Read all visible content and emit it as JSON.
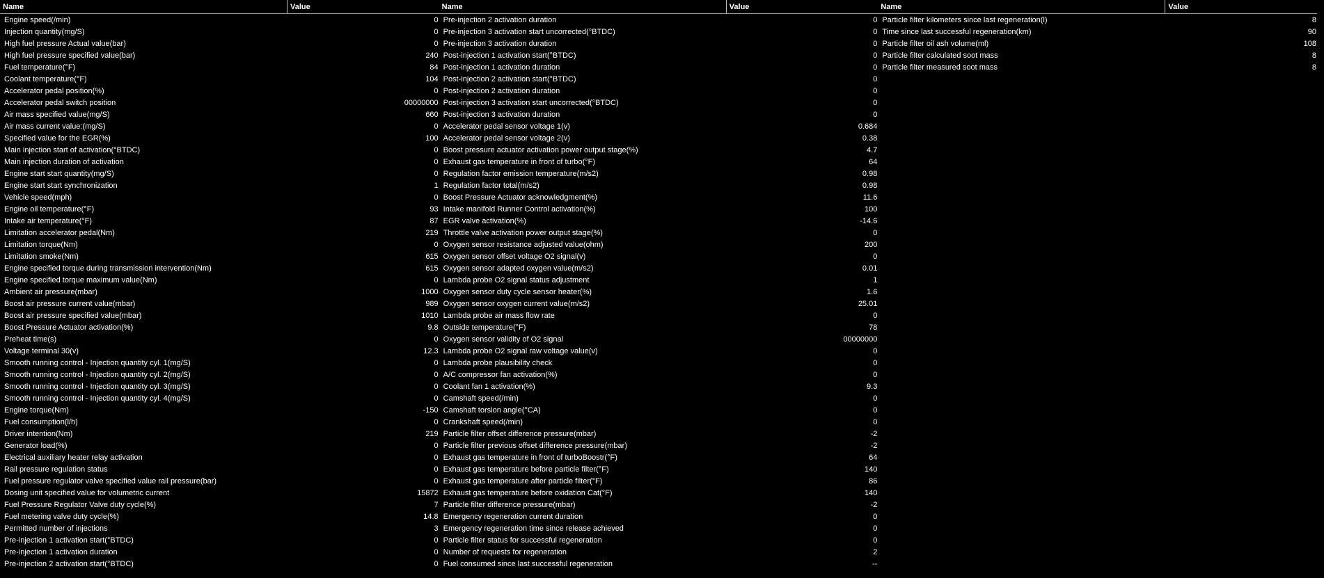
{
  "header": {
    "name_label": "Name",
    "value_label": "Value"
  },
  "panels": [
    [
      [
        "Engine speed(/min)",
        "0"
      ],
      [
        "Injection quantity(mg/S)",
        "0"
      ],
      [
        "High fuel pressure Actual value(bar)",
        "0"
      ],
      [
        "High fuel pressure specified value(bar)",
        "240"
      ],
      [
        "Fuel temperature(°F)",
        "84"
      ],
      [
        "Coolant temperature(°F)",
        "104"
      ],
      [
        "Accelerator pedal position(%)",
        "0"
      ],
      [
        "Accelerator pedal switch position",
        "00000000"
      ],
      [
        "Air mass specified value(mg/S)",
        "660"
      ],
      [
        "Air mass current value:(mg/S)",
        "0"
      ],
      [
        "Specified value for the EGR(%)",
        "100"
      ],
      [
        "Main injection start of activation(°BTDC)",
        "0"
      ],
      [
        "Main injection duration of activation",
        "0"
      ],
      [
        "Engine start start quantity(mg/S)",
        "0"
      ],
      [
        "Engine start start synchronization",
        "1"
      ],
      [
        "Vehicle speed(mph)",
        "0"
      ],
      [
        "Engine oil temperature(°F)",
        "93"
      ],
      [
        "Intake air temperature(°F)",
        "87"
      ],
      [
        "Limitation accelerator pedal(Nm)",
        "219"
      ],
      [
        "Limitation torque(Nm)",
        "0"
      ],
      [
        "Limitation smoke(Nm)",
        "615"
      ],
      [
        "Engine specified torque during transmission intervention(Nm)",
        "615"
      ],
      [
        "Engine specified torque maximum value(Nm)",
        "0"
      ],
      [
        "Ambient air pressure(mbar)",
        "1000"
      ],
      [
        "Boost air pressure current value(mbar)",
        "989"
      ],
      [
        "Boost air pressure specified value(mbar)",
        "1010"
      ],
      [
        "Boost Pressure Actuator activation(%)",
        "9.8"
      ],
      [
        "Preheat time(s)",
        "0"
      ],
      [
        "Voltage terminal 30(v)",
        "12.3"
      ],
      [
        "Smooth running control - Injection quantity cyl. 1(mg/S)",
        "0"
      ],
      [
        "Smooth running control - Injection quantity cyl. 2(mg/S)",
        "0"
      ],
      [
        "Smooth running control - Injection quantity cyl. 3(mg/S)",
        "0"
      ],
      [
        "Smooth running control - Injection quantity cyl. 4(mg/S)",
        "0"
      ],
      [
        "Engine torque(Nm)",
        "-150"
      ],
      [
        "Fuel consumption(l/h)",
        "0"
      ],
      [
        "Driver intention(Nm)",
        "219"
      ],
      [
        "Generator load(%)",
        "0"
      ],
      [
        "Electrical auxiliary heater relay activation",
        "0"
      ],
      [
        "Rail pressure regulation status",
        "0"
      ],
      [
        "Fuel pressure regulator valve specified value rail pressure(bar)",
        "0"
      ],
      [
        "Dosing unit specified value for volumetric current",
        "15872"
      ],
      [
        "Fuel Pressure Regulator Valve duty cycle(%)",
        "7"
      ],
      [
        "Fuel metering valve duty cycle(%)",
        "14.8"
      ],
      [
        "Permitted number of injections",
        "3"
      ],
      [
        "Pre-injection 1 activation start(°BTDC)",
        "0"
      ],
      [
        "Pre-injection 1 activation duration",
        "0"
      ],
      [
        "Pre-injection 2 activation start(°BTDC)",
        "0"
      ]
    ],
    [
      [
        "Pre-injection 2 activation duration",
        "0"
      ],
      [
        "Pre-injection 3 activation start uncorrected(°BTDC)",
        "0"
      ],
      [
        "Pre-injection 3 activation duration",
        "0"
      ],
      [
        "Post-injection 1 activation start(°BTDC)",
        "0"
      ],
      [
        "Post-injection 1 activation duration",
        "0"
      ],
      [
        "Post-injection 2 activation start(°BTDC)",
        "0"
      ],
      [
        "Post-injection 2 activation duration",
        "0"
      ],
      [
        "Post-injection 3 activation start uncorrected(°BTDC)",
        "0"
      ],
      [
        "Post-injection 3 activation duration",
        "0"
      ],
      [
        "Accelerator pedal sensor voltage 1(v)",
        "0.684"
      ],
      [
        "Accelerator pedal sensor voltage 2(v)",
        "0.38"
      ],
      [
        "Boost pressure actuator activation power output stage(%)",
        "4.7"
      ],
      [
        "Exhaust gas temperature in front of turbo(°F)",
        "64"
      ],
      [
        "Regulation factor emission temperature(m/s2)",
        "0.98"
      ],
      [
        "Regulation factor total(m/s2)",
        "0.98"
      ],
      [
        "Boost Pressure Actuator acknowledgment(%)",
        "11.6"
      ],
      [
        "Intake manifold Runner Control activation(%)",
        "100"
      ],
      [
        "EGR valve activation(%)",
        "-14.6"
      ],
      [
        "Throttle valve activation power output stage(%)",
        "0"
      ],
      [
        "Oxygen sensor resistance adjusted value(ohm)",
        "200"
      ],
      [
        "Oxygen sensor offset voltage O2 signal(v)",
        "0"
      ],
      [
        "Oxygen sensor adapted oxygen value(m/s2)",
        "0.01"
      ],
      [
        "Lambda probe O2 signal status adjustment",
        "1"
      ],
      [
        "Oxygen sensor duty cycle sensor heater(%)",
        "1.6"
      ],
      [
        "Oxygen sensor oxygen current value(m/s2)",
        "25.01"
      ],
      [
        "Lambda probe air mass flow rate",
        "0"
      ],
      [
        "Outside temperature(°F)",
        "78"
      ],
      [
        "Oxygen sensor validity of O2 signal",
        "00000000"
      ],
      [
        "Lambda probe O2 signal raw voltage value(v)",
        "0"
      ],
      [
        "Lambda probe plausibility check",
        "0"
      ],
      [
        "A/C compressor fan activation(%)",
        "0"
      ],
      [
        "Coolant fan 1 activation(%)",
        "9.3"
      ],
      [
        "Camshaft speed(/min)",
        "0"
      ],
      [
        "Camshaft torsion angle(°CA)",
        "0"
      ],
      [
        "Crankshaft speed(/min)",
        "0"
      ],
      [
        "Particle filter offset difference pressure(mbar)",
        "-2"
      ],
      [
        "Particle filter previous offset difference pressure(mbar)",
        "-2"
      ],
      [
        "Exhaust gas temperature in front of turboBoostr(°F)",
        "64"
      ],
      [
        "Exhaust gas temperature before particle filter(°F)",
        "140"
      ],
      [
        "Exhaust gas temperature after particle filter(°F)",
        "86"
      ],
      [
        "Exhaust gas temperature before oxidation Cat(°F)",
        "140"
      ],
      [
        "Particle filter difference pressure(mbar)",
        "-2"
      ],
      [
        "Emergency regeneration current duration",
        "0"
      ],
      [
        "Emergency regeneration time since release achieved",
        "0"
      ],
      [
        "Particle filter status for successful regeneration",
        "0"
      ],
      [
        "Number of requests for regeneration",
        "2"
      ],
      [
        "Fuel consumed since last successful regeneration",
        "--"
      ]
    ],
    [
      [
        "Particle filter kilometers since last regeneration(l)",
        "8"
      ],
      [
        "Time since last successful regeneration(km)",
        "90"
      ],
      [
        "Particle filter oil ash volume(ml)",
        "108"
      ],
      [
        "Particle filter calculated soot mass",
        "8"
      ],
      [
        "Particle filter measured soot mass",
        "8"
      ]
    ]
  ]
}
